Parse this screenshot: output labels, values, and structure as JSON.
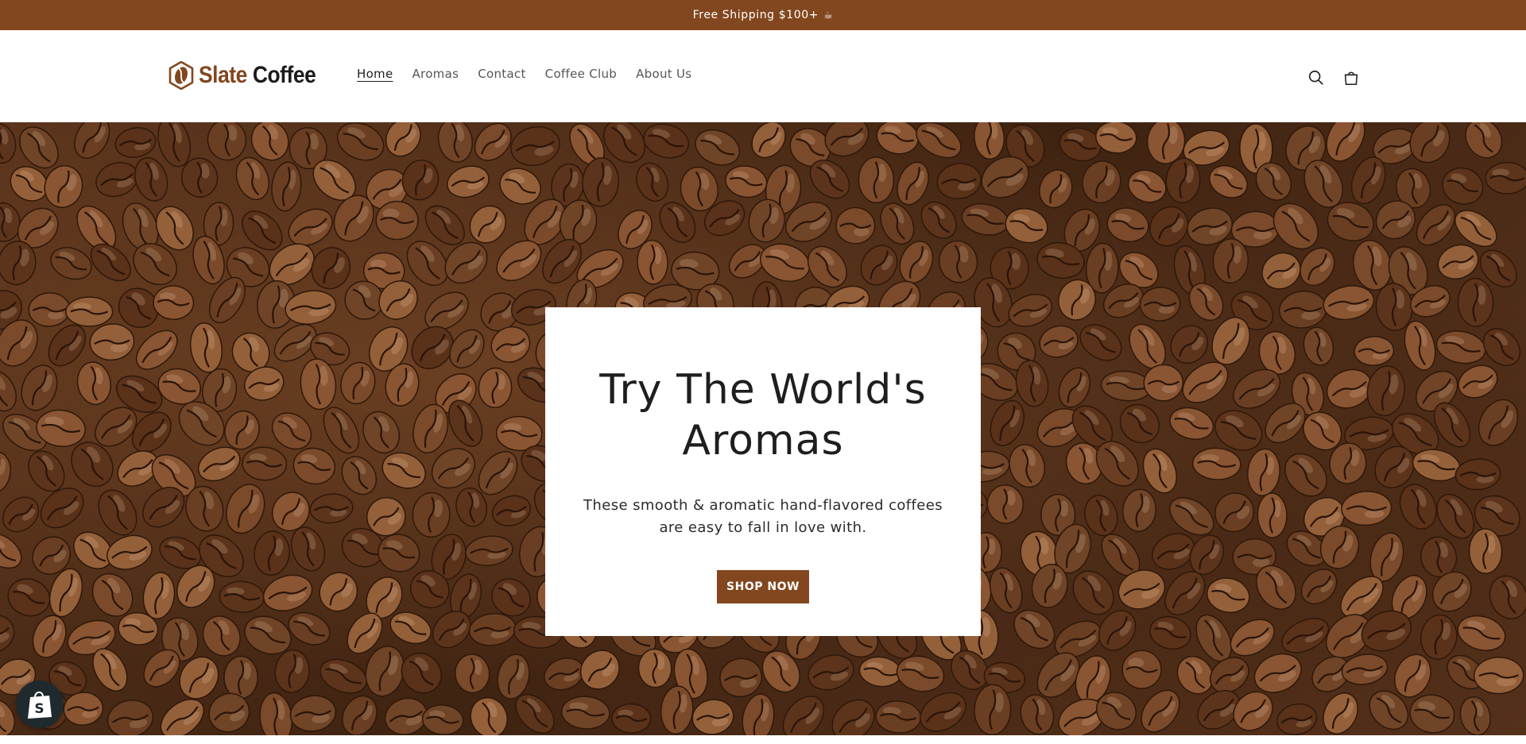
{
  "announcement": {
    "text": "Free Shipping $100+",
    "icon": "coffee-cup-emoji"
  },
  "header": {
    "logo": {
      "word1": "Slate",
      "word2": "Coffee",
      "icon": "coffee-bean-icon"
    },
    "nav": [
      {
        "label": "Home",
        "active": true
      },
      {
        "label": "Aromas",
        "active": false
      },
      {
        "label": "Contact",
        "active": false
      },
      {
        "label": "Coffee Club",
        "active": false
      },
      {
        "label": "About Us",
        "active": false
      }
    ],
    "icons": {
      "search": "search-icon",
      "cart": "cart-icon"
    }
  },
  "hero": {
    "background": "coffee beans photo",
    "title": "Try The World's Aromas",
    "subtitle": "These smooth & aromatic hand-flavored coffees are easy to fall in love with.",
    "button_label": "SHOP NOW"
  },
  "shopify_badge": {
    "icon": "shopify-bag-icon"
  },
  "colors": {
    "brand": "#82471f",
    "text": "#1f1f1f",
    "nav_text": "#555555",
    "white": "#ffffff"
  }
}
